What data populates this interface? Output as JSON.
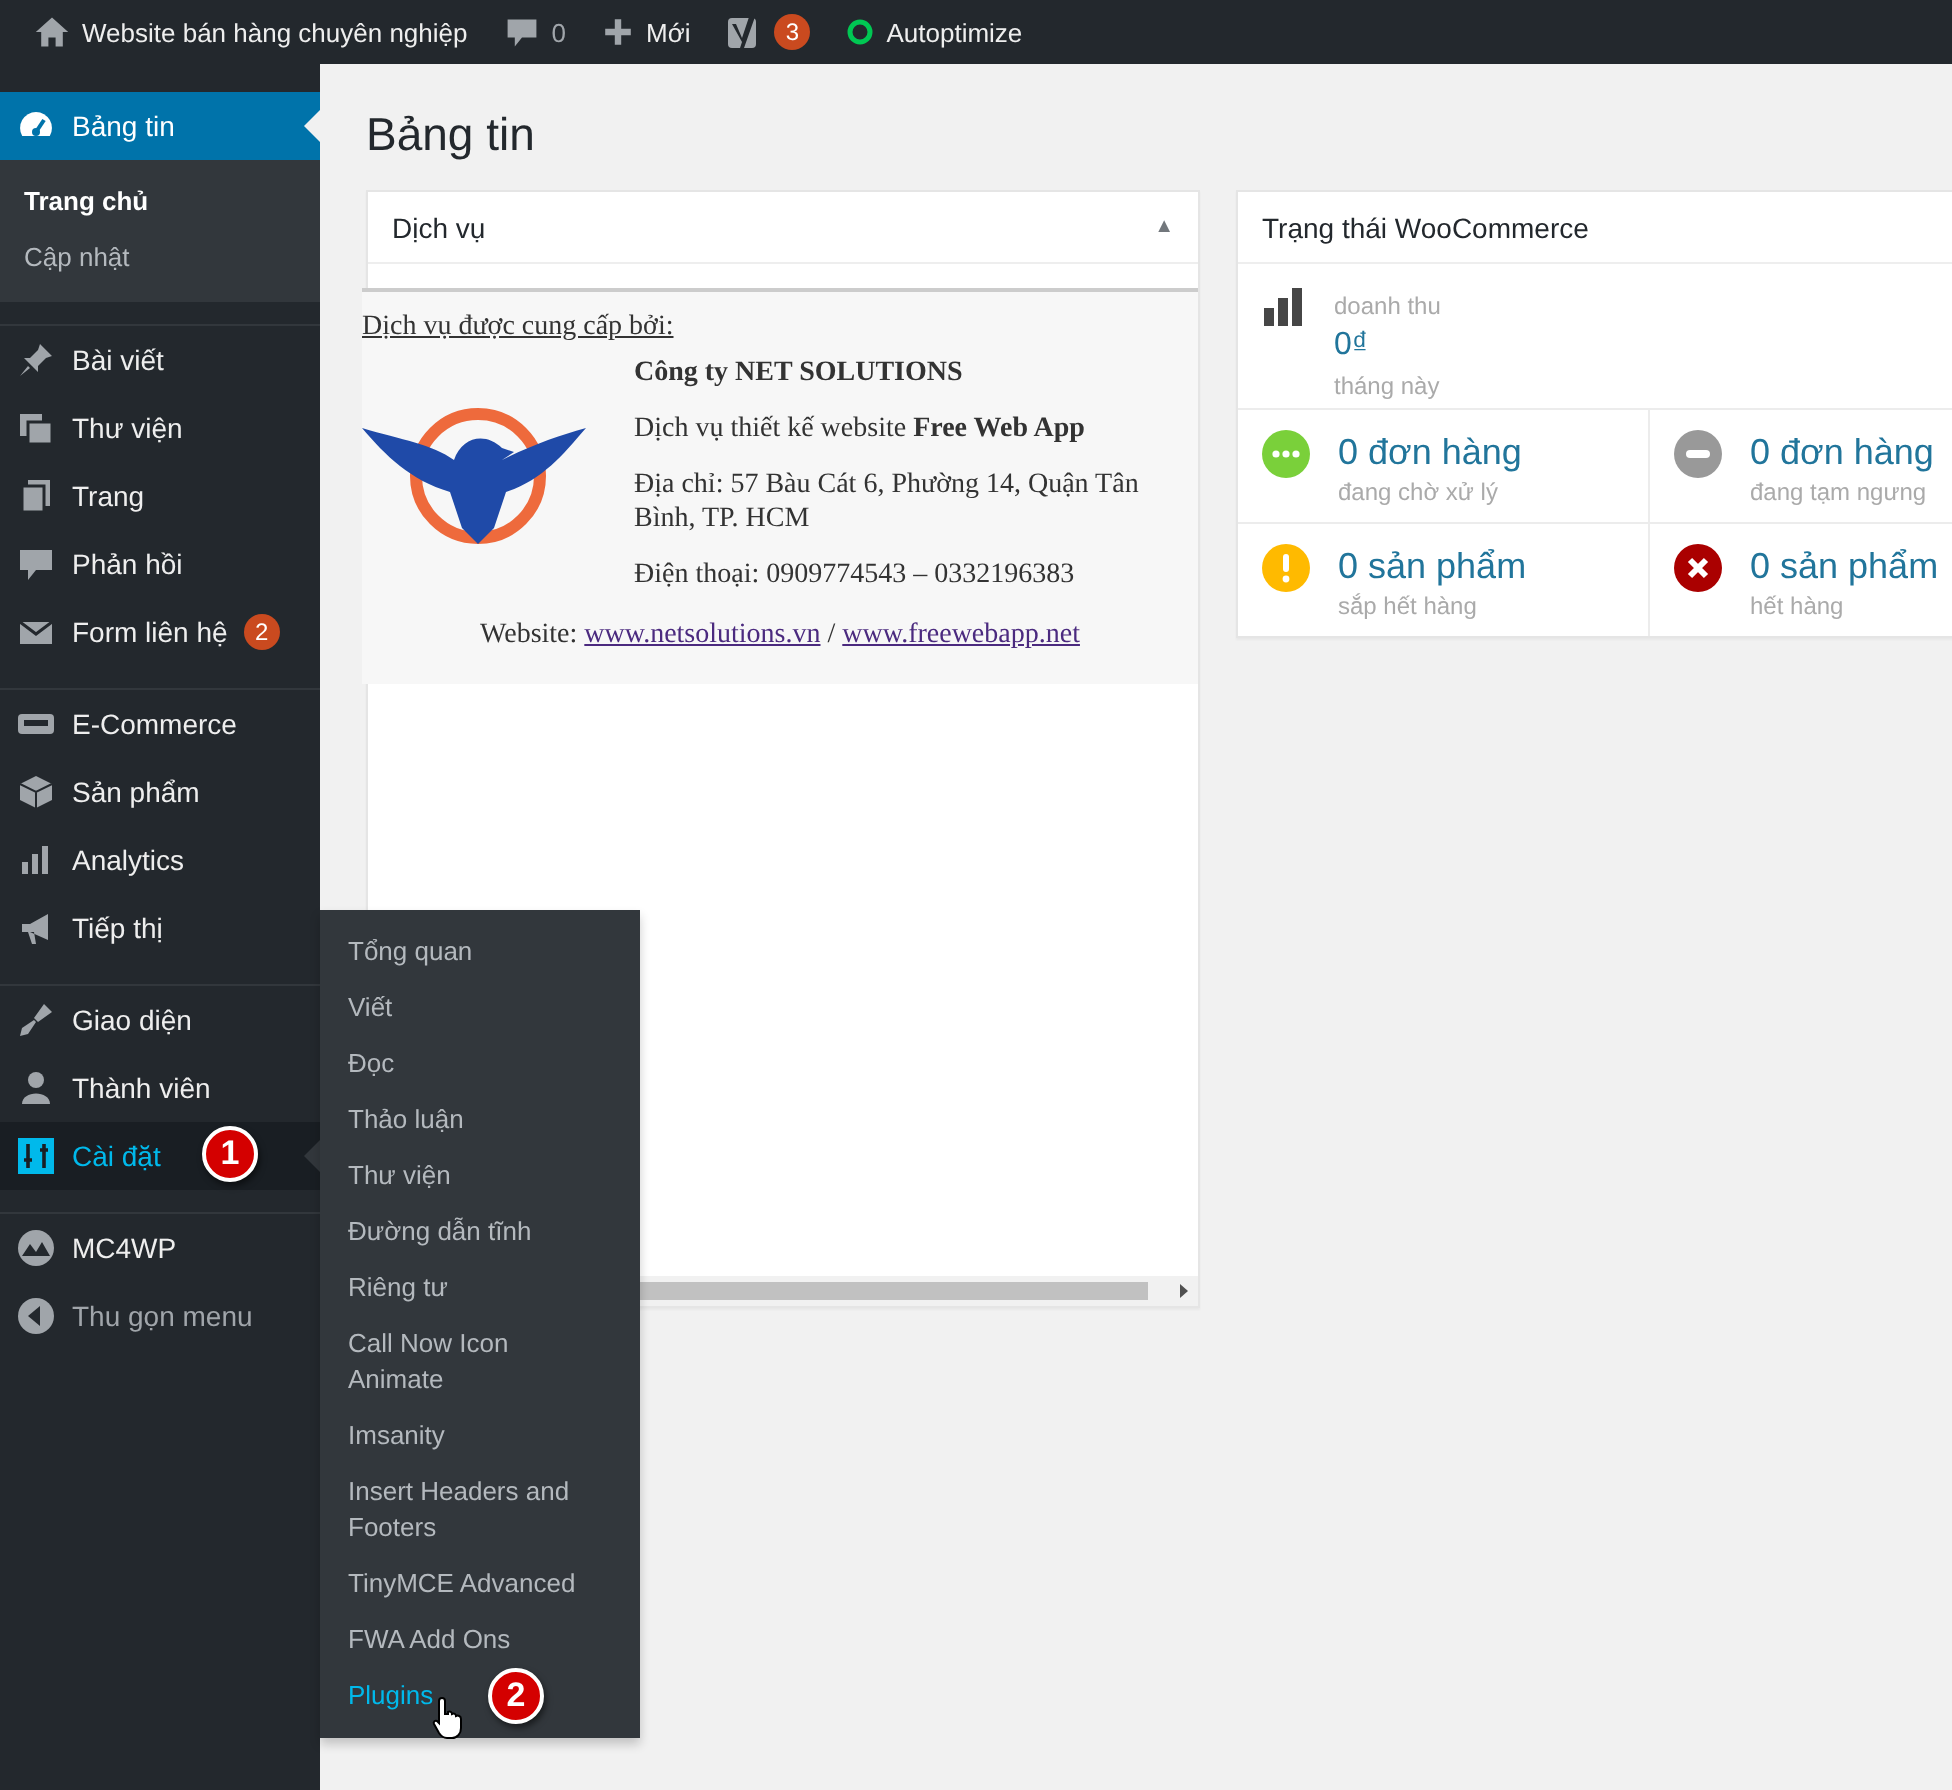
{
  "top_bar": [
    {
      "label": "Website bán hàng chuyên nghiệp"
    },
    {
      "label": "0"
    },
    {
      "label": "Mới"
    },
    {
      "badge": "3"
    },
    {
      "label": "Autoptimize"
    }
  ],
  "sidebar": {
    "groups": [
      [
        {
          "label": "Bảng tin",
          "selected": true,
          "open": false,
          "submenu": [
            {
              "label": "Trang chủ",
              "selected": true
            },
            {
              "label": "Cập nhật",
              "selected": false
            }
          ]
        }
      ],
      [
        {
          "label": "Bài viết",
          "selected": false,
          "open": false
        },
        {
          "label": "Thư viện",
          "selected": false,
          "open": false
        },
        {
          "label": "Trang",
          "selected": false,
          "open": false
        },
        {
          "label": "Phản hồi",
          "selected": false,
          "open": false
        },
        {
          "label": "Form liên hệ",
          "selected": false,
          "open": false,
          "badge": "2"
        }
      ],
      [
        {
          "label": "E-Commerce",
          "selected": false,
          "open": false
        },
        {
          "label": "Sản phẩm",
          "selected": false,
          "open": false
        },
        {
          "label": "Analytics",
          "selected": false,
          "open": false
        },
        {
          "label": "Tiếp thị",
          "selected": false,
          "open": false
        }
      ],
      [
        {
          "label": "Giao diện",
          "selected": false,
          "open": false
        },
        {
          "label": "Thành viên",
          "selected": false,
          "open": false
        },
        {
          "label": "Cài đặt",
          "selected": false,
          "open": true,
          "annotation": "1",
          "flyout": [
            {
              "label": "Tổng quan",
              "selected": false
            },
            {
              "label": "Viết",
              "selected": false
            },
            {
              "label": "Đọc",
              "selected": false
            },
            {
              "label": "Thảo luận",
              "selected": false
            },
            {
              "label": "Thư viện",
              "selected": false
            },
            {
              "label": "Đường dẫn tĩnh",
              "selected": false
            },
            {
              "label": "Riêng tư",
              "selected": false
            },
            {
              "label": "Call Now Icon Animate",
              "selected": false
            },
            {
              "label": "Imsanity",
              "selected": false
            },
            {
              "label": "Insert Headers and Footers",
              "selected": false
            },
            {
              "label": "TinyMCE Advanced",
              "selected": false
            },
            {
              "label": "FWA Add Ons",
              "selected": false
            },
            {
              "label": "Plugins",
              "selected": true,
              "annotation": "2"
            }
          ]
        }
      ],
      [
        {
          "label": "MC4WP",
          "selected": false,
          "open": false
        },
        {
          "label": "Thu gọn menu",
          "selected": false,
          "open": false
        }
      ]
    ]
  },
  "page_title": "Bảng tin",
  "service_box": {
    "title": "Dịch vụ",
    "toggle": "▲",
    "intro": "Dịch vụ được cung cấp bởi:",
    "company": "Công ty NET SOLUTIONS",
    "lines": [
      "Dịch vụ thiết kế website **Free Web App**",
      "Địa chỉ: 57 Bàu Cát 6, Phường 14, Quận Tân Bình, TP. HCM",
      "Điện thoại: 0909774543 – 0332196383"
    ],
    "website": {
      "label": "Website:",
      "links": [
        "www.netsolutions.vn",
        "www.freewebapp.net"
      ],
      "separator": "/"
    }
  },
  "woo_box": {
    "title": "Trạng thái WooCommerce",
    "revenue": {
      "label": "doanh thu",
      "value": "0₫",
      "period": "tháng này"
    },
    "stats": [
      {
        "kind": "processing",
        "color": "#7ad03a",
        "value": "0 đơn hàng",
        "label": "đang chờ xử lý"
      },
      {
        "kind": "on-hold",
        "color": "#999999",
        "value": "0 đơn hàng",
        "label": "đang tạm ngưng"
      },
      {
        "kind": "low-stock",
        "color": "#ffba00",
        "value": "0 sản phẩm",
        "label": "sắp hết hàng"
      },
      {
        "kind": "out-of-stock",
        "color": "#aa0000",
        "value": "0 sản phẩm",
        "label": "hết hàng"
      }
    ]
  }
}
